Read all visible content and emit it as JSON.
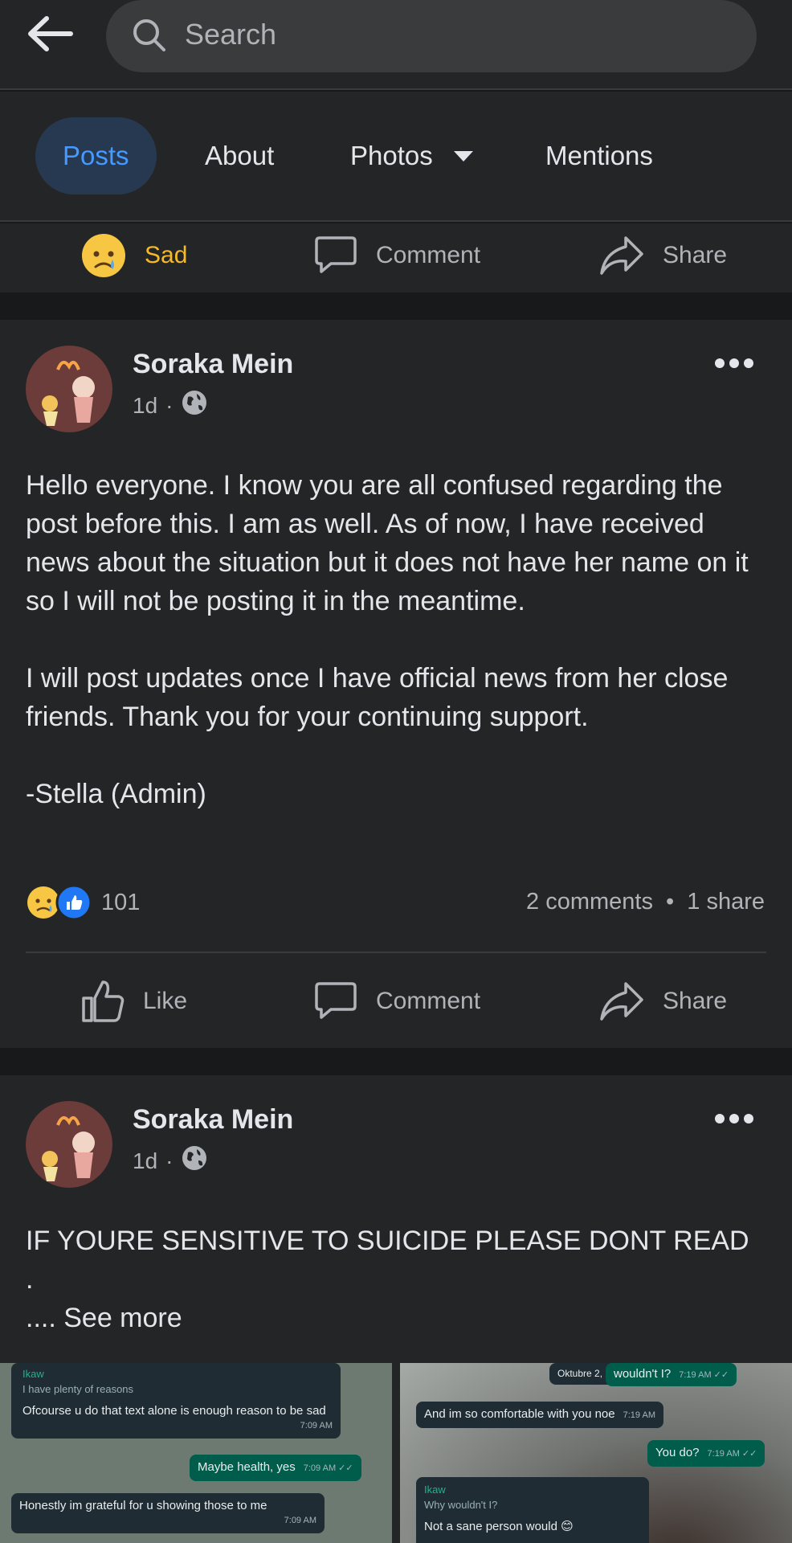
{
  "header": {
    "search_placeholder": "Search"
  },
  "tabs": [
    {
      "label": "Posts"
    },
    {
      "label": "About"
    },
    {
      "label": "Photos"
    },
    {
      "label": "Mentions"
    }
  ],
  "prev_post_actions": {
    "reaction_label": "Sad",
    "comment_label": "Comment",
    "share_label": "Share"
  },
  "post1": {
    "author": "Soraka Mein",
    "time": "1d",
    "dot": "·",
    "paragraphs": [
      "Hello everyone. I know you are all confused regarding the post before this. I am as well. As of now, I have received news about the situation but it does not have her name on it so I will not be posting it in the meantime.",
      "I will post updates once I have official news from her close friends. Thank you for your continuing support.",
      "-Stella (Admin)"
    ],
    "reaction_count": "101",
    "comments": "2 comments",
    "sep": "•",
    "shares": "1 share",
    "like_label": "Like",
    "comment_label": "Comment",
    "share_label": "Share"
  },
  "post2": {
    "author": "Soraka Mein",
    "time": "1d",
    "dot": "·",
    "text": "IF YOURE SENSITIVE TO SUICIDE PLEASE DONT READ",
    "text_dot": ".",
    "see_more": ".... See more"
  },
  "chat_left": {
    "quote_sender": "Ikaw",
    "quote_text": "I have plenty of reasons",
    "msg1": "Ofcourse u do that text alone is enough reason to be sad",
    "msg1_time": "7:09 AM",
    "msg2": "Maybe health, yes",
    "msg2_time": "7:09 AM ✓✓",
    "msg3": "Honestly im grateful for u showing those to me",
    "msg3_time": "7:09 AM"
  },
  "chat_right": {
    "date": "Oktubre 2, 2022",
    "msg1": "wouldn't I?",
    "msg1_time": "7:19 AM ✓✓",
    "msg2": "And im so comfortable with you noe",
    "msg2_time": "7:19 AM",
    "msg3": "You do?",
    "msg3_time": "7:19 AM ✓✓",
    "quote_sender": "Ikaw",
    "quote_text": "Why wouldn't I?",
    "msg4": "Not a sane person would 😊"
  }
}
